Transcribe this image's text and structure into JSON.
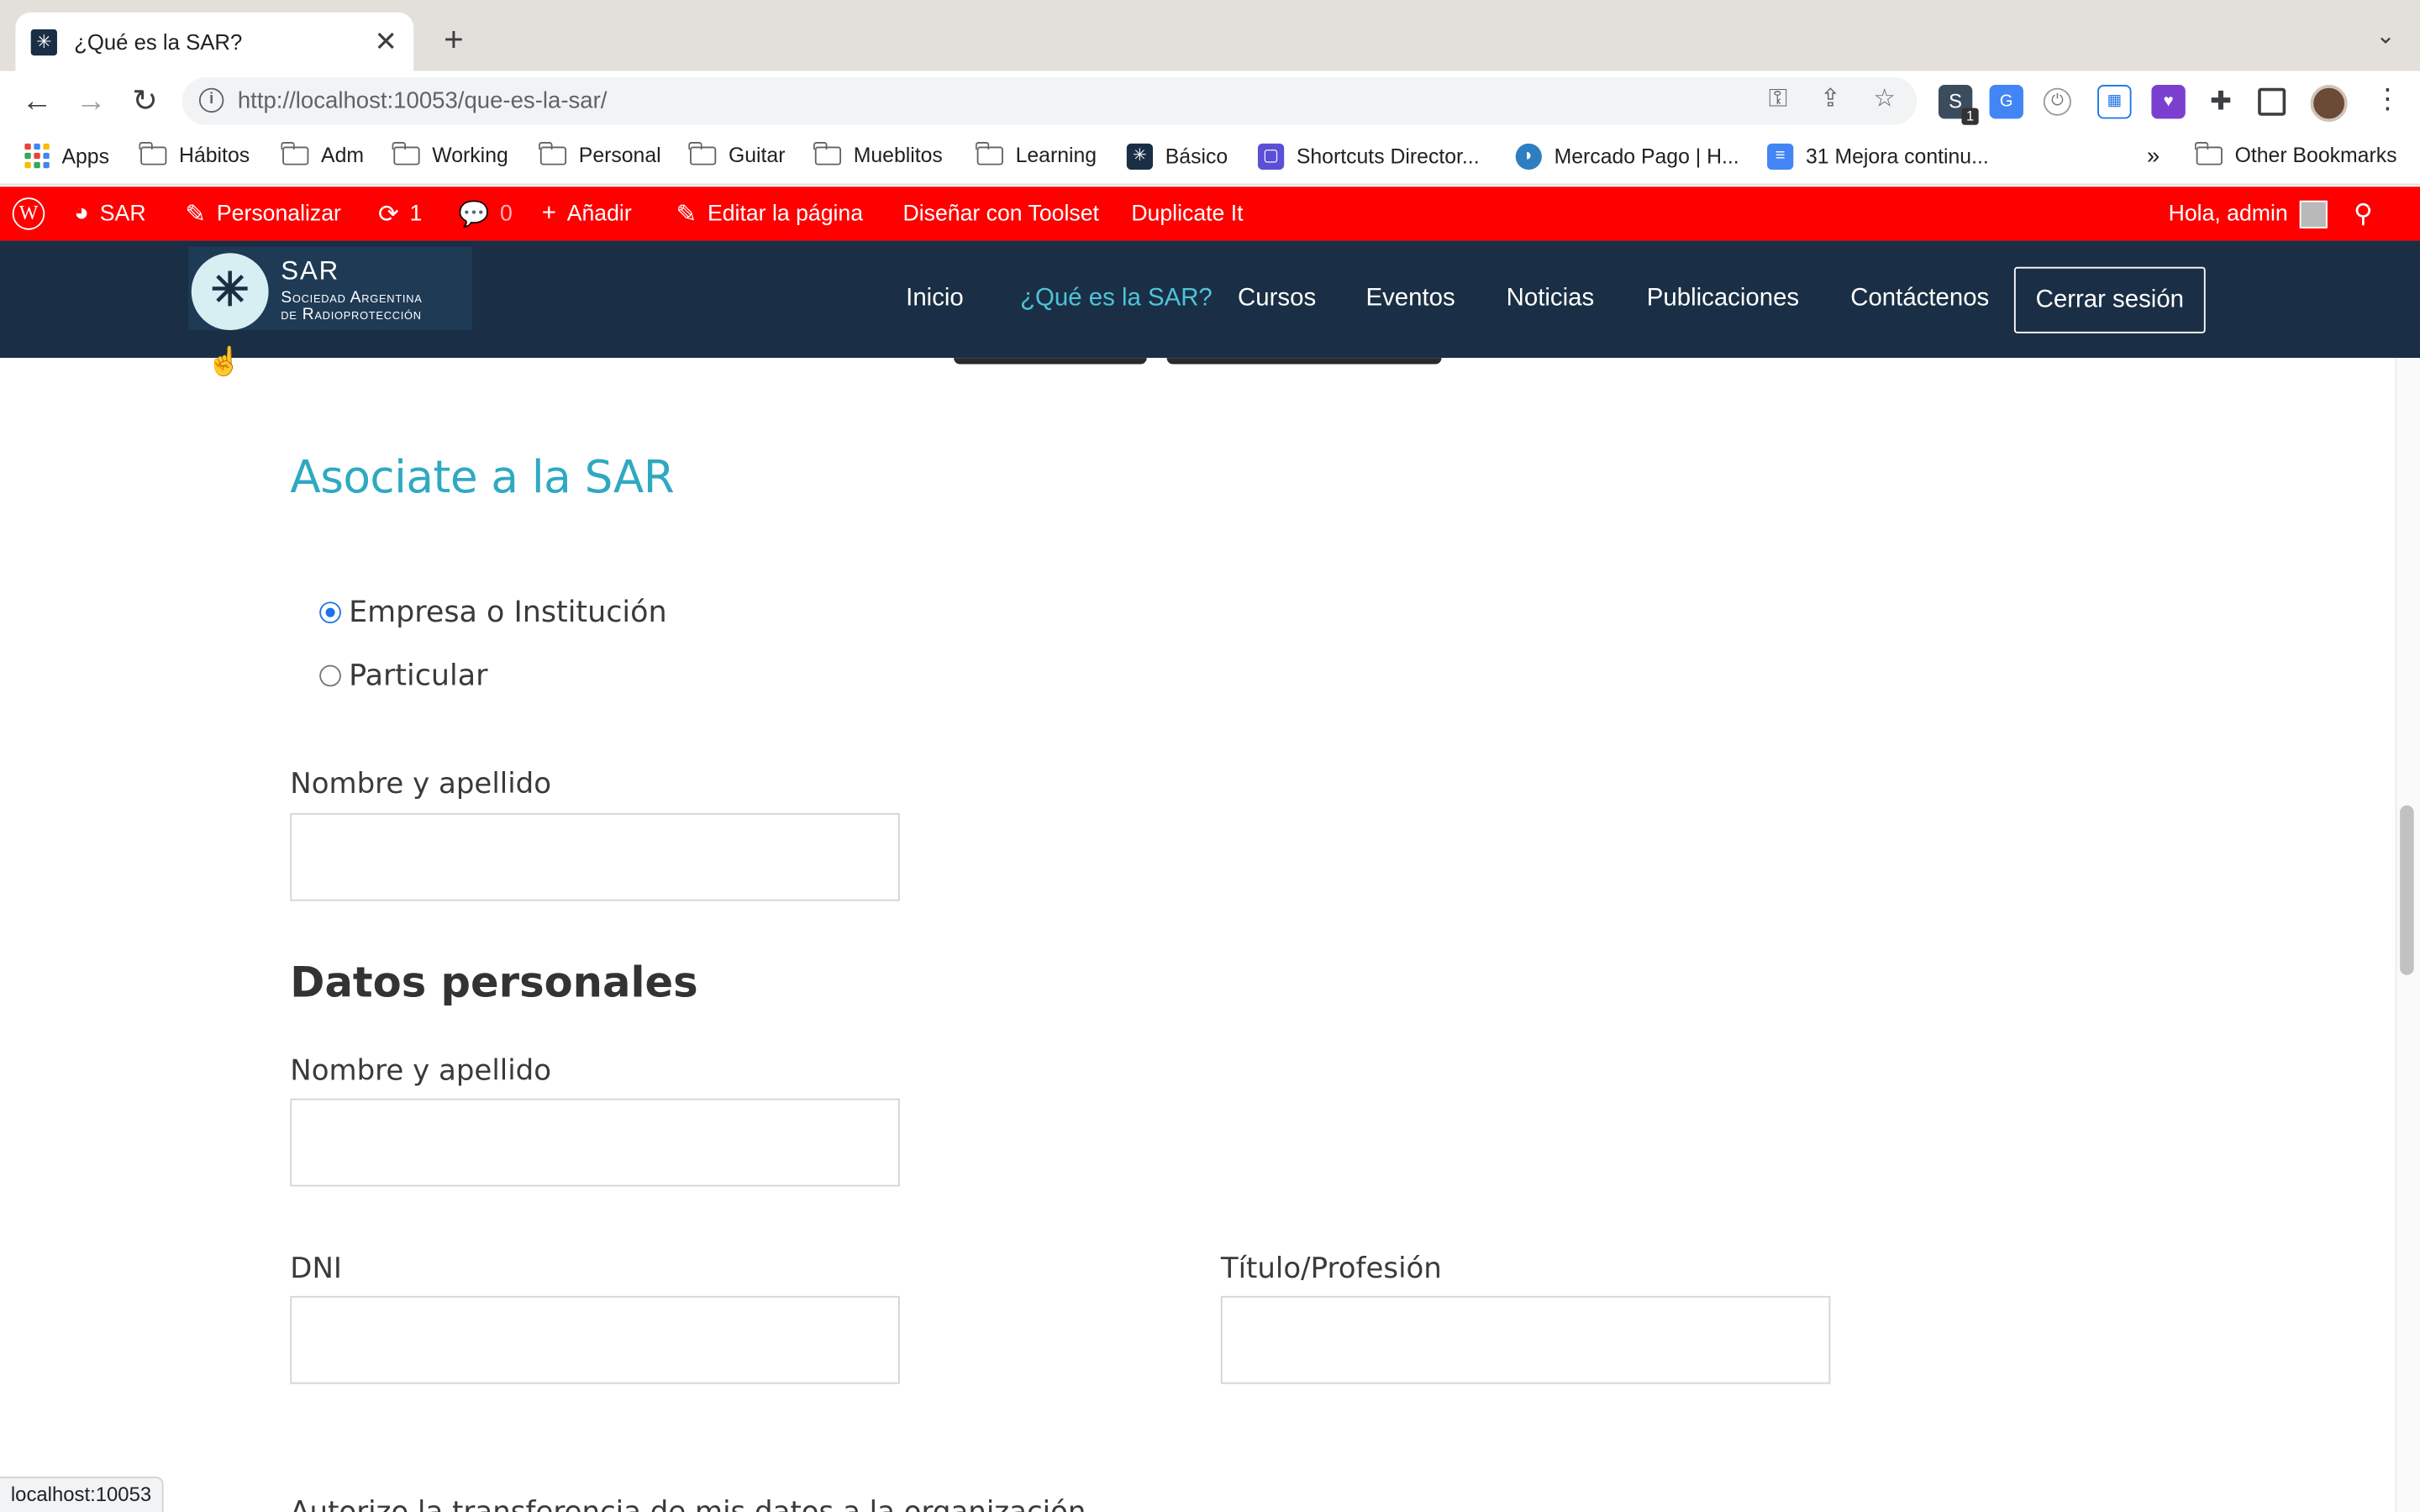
{
  "browser": {
    "tab_title": "¿Qué es la SAR?",
    "tab_close": "✕",
    "new_tab": "+",
    "tab_menu": "⌄",
    "url_host": "http://localhost",
    "url_path": ":10053/que-es-la-sar/",
    "status_url": "localhost:10053",
    "extension_badge": "1"
  },
  "bookmarks": [
    {
      "label": "Apps",
      "icon": "apps-grid-icon"
    },
    {
      "label": "Hábitos",
      "icon": "folder-icon"
    },
    {
      "label": "Adm",
      "icon": "folder-icon"
    },
    {
      "label": "Working",
      "icon": "folder-icon"
    },
    {
      "label": "Personal",
      "icon": "folder-icon"
    },
    {
      "label": "Guitar",
      "icon": "folder-icon"
    },
    {
      "label": "Mueblitos",
      "icon": "folder-icon"
    },
    {
      "label": "Learning",
      "icon": "folder-icon"
    },
    {
      "label": "Básico",
      "icon": "sar-favicon"
    },
    {
      "label": "Shortcuts Director...",
      "icon": "shortcuts-icon"
    },
    {
      "label": "Mercado Pago | H...",
      "icon": "mercadopago-icon"
    },
    {
      "label": "31 Mejora continu...",
      "icon": "docs-icon"
    },
    {
      "label": "»",
      "icon": "overflow-chevron"
    },
    {
      "label": "Other Bookmarks",
      "icon": "folder-icon"
    }
  ],
  "adminbar": {
    "site": "SAR",
    "customize": "Personalizar",
    "updates_count": "1",
    "comments_count": "0",
    "add_new": "Añadir",
    "edit_page": "Editar la página",
    "toolset": "Diseñar con Toolset",
    "duplicate": "Duplicate It",
    "greeting": "Hola, admin"
  },
  "site": {
    "logo_title": "SAR",
    "logo_sub1": "Sociedad Argentina",
    "logo_sub2": "de Radioprotección",
    "menu": [
      "Inicio",
      "¿Qué es la SAR?",
      "Cursos",
      "Eventos",
      "Noticias",
      "Publicaciones",
      "Contáctenos"
    ],
    "active_menu": "¿Qué es la SAR?",
    "logout": "Cerrar sesión"
  },
  "form": {
    "heading": "Asociate a la SAR",
    "radio_options": [
      "Empresa o Institución",
      "Particular"
    ],
    "selected_option": "Empresa o Institución",
    "label_name_company": "Nombre y apellido",
    "section_personal": "Datos personales",
    "label_name": "Nombre y apellido",
    "label_dni": "DNI",
    "label_title": "Título/Profesión",
    "cutoff_text": "Autorizo la transferencia de mis datos a la organización"
  },
  "colors": {
    "adminbar": "#ff0000",
    "header": "#1a2f45",
    "accent": "#2fa9c2",
    "radio_selected": "#1a73e8"
  }
}
